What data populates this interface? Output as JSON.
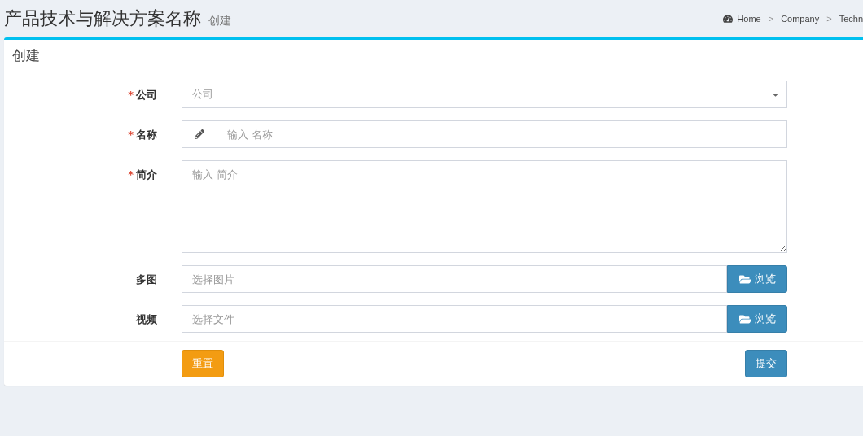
{
  "header": {
    "title": "产品技术与解决方案名称",
    "subtitle": "创建"
  },
  "breadcrumb": [
    {
      "kind": "home",
      "label": "Home"
    },
    {
      "kind": "link",
      "label": "Company",
      "separator": ">"
    },
    {
      "kind": "link",
      "label": "Techn",
      "separator": ">"
    }
  ],
  "box": {
    "title": "创建"
  },
  "fields": [
    {
      "kind": "select",
      "label": "公司",
      "required_mark": "*",
      "placeholder": "公司"
    },
    {
      "kind": "icon-input",
      "label": "名称",
      "required_mark": "*",
      "placeholder": "输入 名称"
    },
    {
      "kind": "textarea",
      "label": "简介",
      "required_mark": "*",
      "placeholder": "输入 简介"
    },
    {
      "kind": "file",
      "label": "多图",
      "placeholder": "选择图片",
      "button": "浏览"
    },
    {
      "kind": "file",
      "label": "视频",
      "placeholder": "选择文件",
      "button": "浏览"
    }
  ],
  "buttons": [
    {
      "kind": "reset",
      "label": "重置"
    },
    {
      "kind": "submit",
      "label": "提交"
    }
  ]
}
